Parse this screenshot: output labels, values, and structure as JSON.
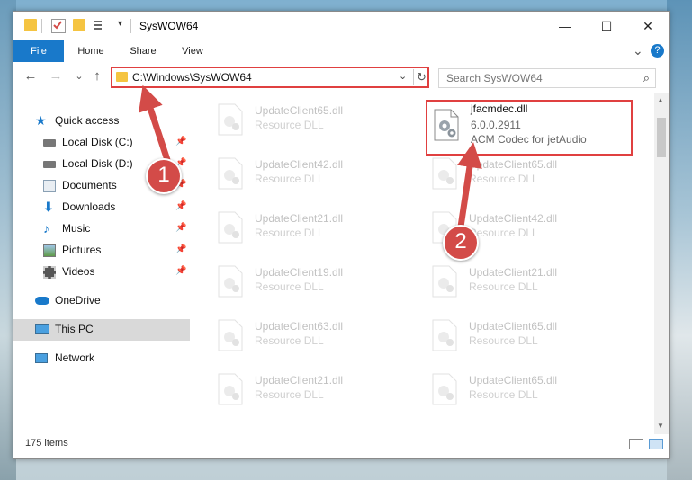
{
  "window": {
    "title": "SysWOW64",
    "minimize": "—",
    "maximize": "☐",
    "close": "✕"
  },
  "ribbon": {
    "tabs": [
      "File",
      "Home",
      "Share",
      "View"
    ],
    "expand": "⌄",
    "help": "?"
  },
  "nav_buttons": {
    "back": "←",
    "forward": "→",
    "recent": "⌄",
    "up": "↑"
  },
  "address": {
    "path": "C:\\Windows\\SysWOW64",
    "dropdown": "⌄",
    "refresh": "↻"
  },
  "search": {
    "placeholder": "Search SysWOW64",
    "icon": "⌕"
  },
  "nav_pane": {
    "items": [
      {
        "label": "Quick access",
        "icon": "star-icon",
        "pinned": false
      },
      {
        "label": "Local Disk (C:)",
        "icon": "drive-icon",
        "pinned": true
      },
      {
        "label": "Local Disk (D:)",
        "icon": "drive-icon",
        "pinned": true
      },
      {
        "label": "Documents",
        "icon": "documents-icon",
        "pinned": true
      },
      {
        "label": "Downloads",
        "icon": "downloads-icon",
        "pinned": true
      },
      {
        "label": "Music",
        "icon": "music-icon",
        "pinned": true
      },
      {
        "label": "Pictures",
        "icon": "pictures-icon",
        "pinned": true
      },
      {
        "label": "Videos",
        "icon": "videos-icon",
        "pinned": true
      },
      {
        "label": "OneDrive",
        "icon": "onedrive-icon",
        "pinned": false
      },
      {
        "label": "This PC",
        "icon": "pc-icon",
        "pinned": false,
        "selected": true
      },
      {
        "label": "Network",
        "icon": "network-icon",
        "pinned": false
      }
    ],
    "pin_glyph": "📌"
  },
  "files": {
    "left_column": [
      {
        "name": "UpdateClient65.dll",
        "type": "Resource DLL"
      },
      {
        "name": "UpdateClient42.dll",
        "type": "Resource DLL"
      },
      {
        "name": "UpdateClient21.dll",
        "type": "Resource DLL"
      },
      {
        "name": "UpdateClient19.dll",
        "type": "Resource DLL"
      },
      {
        "name": "UpdateClient63.dll",
        "type": "Resource DLL"
      },
      {
        "name": "UpdateClient21.dll",
        "type": "Resource DLL"
      }
    ],
    "highlighted": {
      "name": "jfacmdec.dll",
      "version": "6.0.0.2911",
      "description": "ACM Codec for jetAudio"
    },
    "right_column": [
      {
        "name": "UpdateClient65.dll",
        "type": "Resource DLL"
      },
      {
        "name": "UpdateClient42.dll",
        "type": "Resource DLL"
      },
      {
        "name": "UpdateClient21.dll",
        "type": "Resource DLL"
      },
      {
        "name": "UpdateClient65.dll",
        "type": "Resource DLL"
      },
      {
        "name": "UpdateClient65.dll",
        "type": "Resource DLL"
      }
    ]
  },
  "status": {
    "item_count": "175 items"
  },
  "callouts": [
    "1",
    "2"
  ],
  "colors": {
    "accent": "#1979ca",
    "highlight": "#e04040",
    "callout": "#d34b48",
    "folder": "#f5c441"
  }
}
